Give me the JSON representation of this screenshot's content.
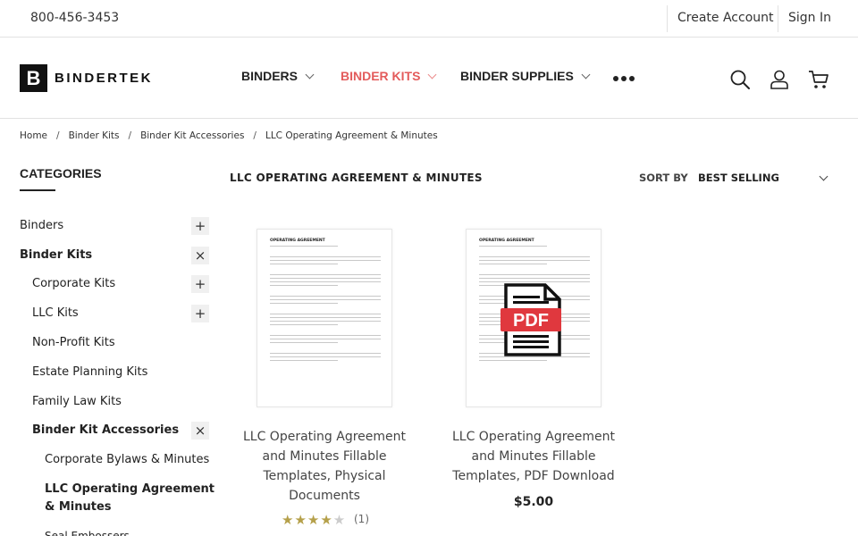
{
  "topbar": {
    "phone": "800-456-3453",
    "create_account": "Create Account",
    "sign_in": "Sign In"
  },
  "header": {
    "logo_mark": "B",
    "logo_text": "BINDERTEK",
    "nav": [
      {
        "label": "BINDERS"
      },
      {
        "label": "BINDER KITS"
      },
      {
        "label": "BINDER SUPPLIES"
      }
    ],
    "icons": [
      "search-icon",
      "user-icon",
      "cart-icon"
    ],
    "accent": "#e35b5b"
  },
  "breadcrumb": [
    "Home",
    "Binder Kits",
    "Binder Kit Accessories",
    "LLC Operating Agreement & Minutes"
  ],
  "sidebar": {
    "title": "CATEGORIES",
    "items": [
      {
        "label": "Binders",
        "toggle": "+"
      },
      {
        "label": "Binder Kits",
        "toggle": "×"
      },
      {
        "label": "Corporate Kits",
        "toggle": "+"
      },
      {
        "label": "LLC Kits",
        "toggle": "+"
      },
      {
        "label": "Non-Profit Kits"
      },
      {
        "label": "Estate Planning Kits"
      },
      {
        "label": "Family Law Kits"
      },
      {
        "label": "Binder Kit Accessories",
        "toggle": "×"
      },
      {
        "label": "Corporate Bylaws & Minutes"
      },
      {
        "label": "LLC Operating Agreement & Minutes"
      },
      {
        "label": "Seal Embossers"
      }
    ]
  },
  "main": {
    "heading": "LLC OPERATING AGREEMENT & MINUTES",
    "sort_label": "SORT BY",
    "sort_value": "BEST SELLING",
    "products": [
      {
        "title": "LLC Operating Agreement and Minutes Fillable Templates, Physical Documents",
        "doc_title": "OPERATING AGREEMENT",
        "rating": 4,
        "rating_max": 5,
        "rating_count": "(1)"
      },
      {
        "title": "LLC Operating Agreement and Minutes Fillable Templates, PDF Download",
        "doc_title": "OPERATING AGREEMENT",
        "pdf_label": "PDF",
        "price": "$5.00"
      }
    ]
  }
}
